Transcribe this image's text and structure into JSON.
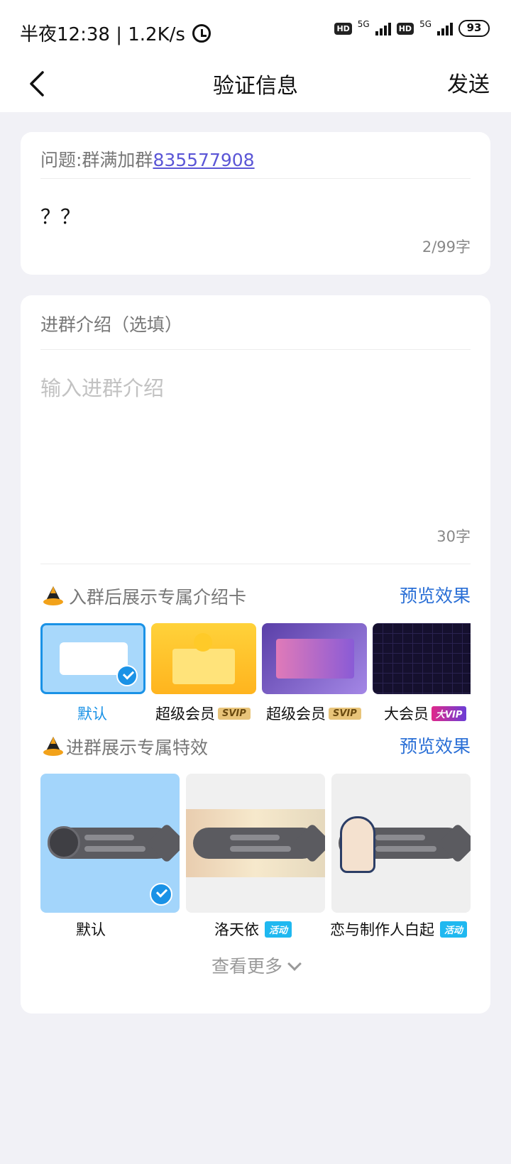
{
  "status": {
    "time": "半夜12:38 | 1.2K/s",
    "net1": "5G",
    "net2": "5G",
    "hd": "HD",
    "battery": "93"
  },
  "header": {
    "title": "验证信息",
    "send": "发送"
  },
  "question": {
    "prefix": "问题:群满加群",
    "group_number": "835577908",
    "answer": "？？",
    "count": "2/99字"
  },
  "intro": {
    "title": "进群介绍（选填）",
    "placeholder": "输入进群介绍",
    "count": "30字"
  },
  "cards_section": {
    "title": "入群后展示专属介绍卡",
    "preview": "预览效果",
    "items": [
      {
        "label": "默认",
        "selected": true
      },
      {
        "label": "超级会员",
        "badge": "SVIP"
      },
      {
        "label": "超级会员",
        "badge": "SVIP"
      },
      {
        "label": "大会员",
        "badge": "大VIP"
      }
    ]
  },
  "effects_section": {
    "title": "进群展示专属特效",
    "preview": "预览效果",
    "items": [
      {
        "label": "默认",
        "selected": true
      },
      {
        "label": "洛天依",
        "badge": "活动"
      },
      {
        "label": "恋与制作人白起",
        "badge": "活动"
      }
    ],
    "more": "查看更多"
  },
  "colors": {
    "accent": "#1a92e6",
    "link": "#2a6fd6",
    "group_link": "#5b56d6",
    "background": "#f1f1f6"
  }
}
